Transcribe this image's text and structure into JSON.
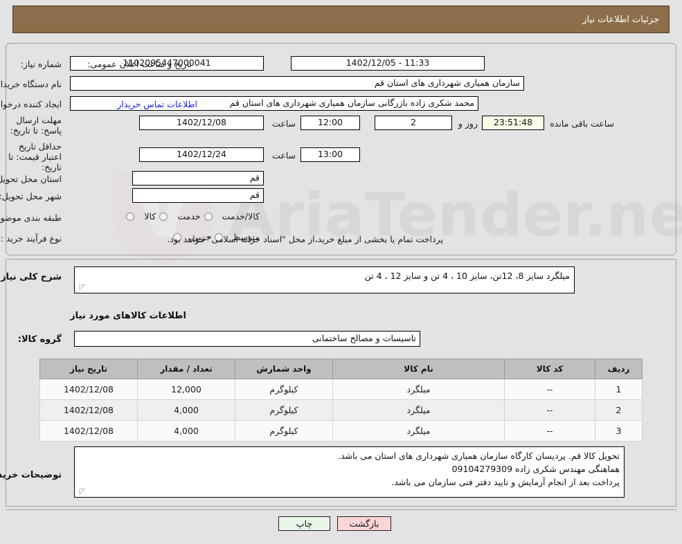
{
  "header": {
    "title": "جزئیات اطلاعات نیاز"
  },
  "form": {
    "need_number_label": "شماره نیاز:",
    "need_number_value": "1102095447000041",
    "announce_label": "تاریخ و ساعت اعلان عمومی:",
    "announce_value": "11:33 - 1402/12/05",
    "buyer_org_label": "نام دستگاه خریدار:",
    "buyer_org_value": "سازمان همیاری شهرداری های استان قم",
    "creator_label": "ایجاد کننده درخواست:",
    "creator_value": "محمد شکری زاده بازرگانی سازمان همیاری شهرداری های استان قم",
    "contact_link": "اطلاعات تماس خریدار",
    "deadline_label": "مهلت ارسال پاسخ: تا تاریخ:",
    "deadline_date": "1402/12/08",
    "hour_label": "ساعت",
    "deadline_time": "12:00",
    "days_value": "2",
    "days_unit_label": "روز و",
    "countdown_value": "23:51:48",
    "countdown_suffix_label": "ساعت باقی مانده",
    "price_validity_label": "حداقل تاریخ اعتبار قیمت: تا تاریخ:",
    "price_validity_date": "1402/12/24",
    "price_validity_time": "13:00",
    "province_label": "استان محل تحویل:",
    "province_value": "قم",
    "city_label": "شهر محل تحویل:",
    "city_value": "قم",
    "classification_label": "طبقه بندی موضوعی:",
    "classification_options": [
      "کالا",
      "خدمت",
      "کالا/خدمت"
    ],
    "classification_selected": "",
    "process_label": "نوع فرآیند خرید :",
    "process_options": [
      "جزیی",
      "متوسط"
    ],
    "process_selected": "",
    "process_note": "پرداخت تمام یا بخشی از مبلغ خرید،از محل \"اسناد خزانه اسلامی\" خواهد بود."
  },
  "summary": {
    "label": "شرح کلی نیاز:",
    "value": "میلگرد سایز 8، 12تن، سایز 10 ، 4 تن و سایز 12 ، 4 تن"
  },
  "goods_section": {
    "title": "اطلاعات کالاهای مورد نیاز",
    "group_label": "گروه کالا:",
    "group_value": "تاسیسات و مصالح ساختمانی"
  },
  "items_table": {
    "headers": [
      "ردیف",
      "کد کالا",
      "نام کالا",
      "واحد شمارش",
      "تعداد / مقدار",
      "تاریخ نیاز"
    ],
    "rows": [
      {
        "row": "1",
        "code": "--",
        "name": "میلگرد",
        "unit": "کیلوگرم",
        "qty": "12,000",
        "date": "1402/12/08"
      },
      {
        "row": "2",
        "code": "--",
        "name": "میلگرد",
        "unit": "کیلوگرم",
        "qty": "4,000",
        "date": "1402/12/08"
      },
      {
        "row": "3",
        "code": "--",
        "name": "میلگرد",
        "unit": "کیلوگرم",
        "qty": "4,000",
        "date": "1402/12/08"
      }
    ]
  },
  "buyer_notes": {
    "label": "توضیحات خریدار:",
    "value": "تحویل کالا قم. پردیسان کارگاه سازمان همیاری شهرداری های استان می باشد.\nهماهنگی مهندس شکری زاده 09104279309\nپرداخت بعد از انجام آزمایش و تایید دفتر فنی سازمان می باشد."
  },
  "footer": {
    "print_label": "چاپ",
    "back_label": "بازگشت"
  },
  "watermark": {
    "text": "AriaTender.net"
  },
  "colors": {
    "header_bg": "#8d6e4a",
    "page_bg": "#e3e3e3",
    "link": "#2222dd",
    "countdown_bg": "#fbfbe8",
    "print_bg": "#e8f6e8",
    "back_bg": "#fbd6d6",
    "table_header_bg": "#bfbfbf"
  }
}
